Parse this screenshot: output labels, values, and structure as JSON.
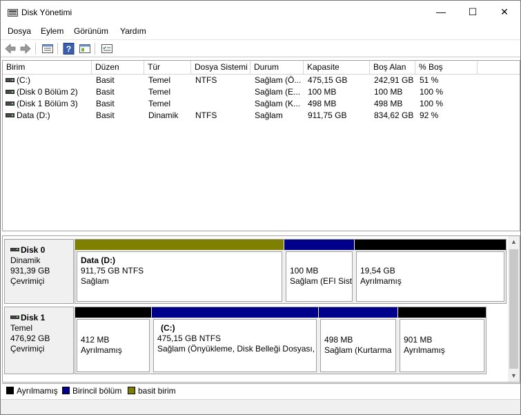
{
  "window": {
    "title": "Disk Yönetimi",
    "minimize_symbol": "—",
    "maximize_symbol": "☐",
    "close_symbol": "✕"
  },
  "menu": [
    "Dosya",
    "Eylem",
    "Görünüm",
    "Yardım"
  ],
  "toolbar": {
    "icons": [
      "back-arrow-icon",
      "forward-arrow-icon",
      "properties-icon",
      "help-icon",
      "show-hide-icon",
      "settings-list-icon"
    ]
  },
  "volume_list": {
    "columns": [
      "Birim",
      "Düzen",
      "Tür",
      "Dosya Sistemi",
      "Durum",
      "Kapasite",
      "Boş Alan",
      "% Boş"
    ],
    "rows": [
      [
        "(C:)",
        "Basit",
        "Temel",
        "NTFS",
        "Sağlam (Ö...",
        "475,15 GB",
        "242,91 GB",
        "51 %"
      ],
      [
        "(Disk 0 Bölüm 2)",
        "Basit",
        "Temel",
        "",
        "Sağlam (E...",
        "100 MB",
        "100 MB",
        "100 %"
      ],
      [
        "(Disk 1 Bölüm 3)",
        "Basit",
        "Temel",
        "",
        "Sağlam (K...",
        "498 MB",
        "498 MB",
        "100 %"
      ],
      [
        "Data (D:)",
        "Basit",
        "Dinamik",
        "NTFS",
        "Sağlam",
        "911,75 GB",
        "834,62 GB",
        "92 %"
      ]
    ]
  },
  "disks": [
    {
      "name": "Disk 0",
      "type": "Dinamik",
      "size": "931,39 GB",
      "status": "Çevrimiçi",
      "partitions": [
        {
          "title": "Data  (D:)",
          "line1": "911,75 GB NTFS",
          "line2": "Sağlam",
          "kind": "basic",
          "color": "#808000"
        },
        {
          "title": "",
          "line1": "100 MB",
          "line2": "Sağlam (EFI Siste",
          "kind": "primary",
          "color": "#00008b"
        },
        {
          "title": "",
          "line1": "19,54 GB",
          "line2": "Ayrılmamış",
          "kind": "unallocated",
          "color": "#000000"
        }
      ]
    },
    {
      "name": "Disk 1",
      "type": "Temel",
      "size": "476,92 GB",
      "status": "Çevrimiçi",
      "partitions": [
        {
          "title": "",
          "line1": "412 MB",
          "line2": "Ayrılmamış",
          "kind": "unallocated",
          "color": "#000000"
        },
        {
          "title": "(C:)",
          "line1": "475,15 GB NTFS",
          "line2": "Sağlam (Önyükleme, Disk Belleği Dosyası, K",
          "kind": "primary",
          "color": "#00008b"
        },
        {
          "title": "",
          "line1": "498 MB",
          "line2": "Sağlam (Kurtarma",
          "kind": "primary",
          "color": "#00008b"
        },
        {
          "title": "",
          "line1": "901 MB",
          "line2": "Ayrılmamış",
          "kind": "unallocated",
          "color": "#000000"
        }
      ]
    }
  ],
  "legend": [
    {
      "label": "Ayrılmamış",
      "color": "#000000"
    },
    {
      "label": "Birincil bölüm",
      "color": "#00008b"
    },
    {
      "label": "basit birim",
      "color": "#808000"
    }
  ],
  "scroll": {
    "up": "▲",
    "down": "▼"
  }
}
